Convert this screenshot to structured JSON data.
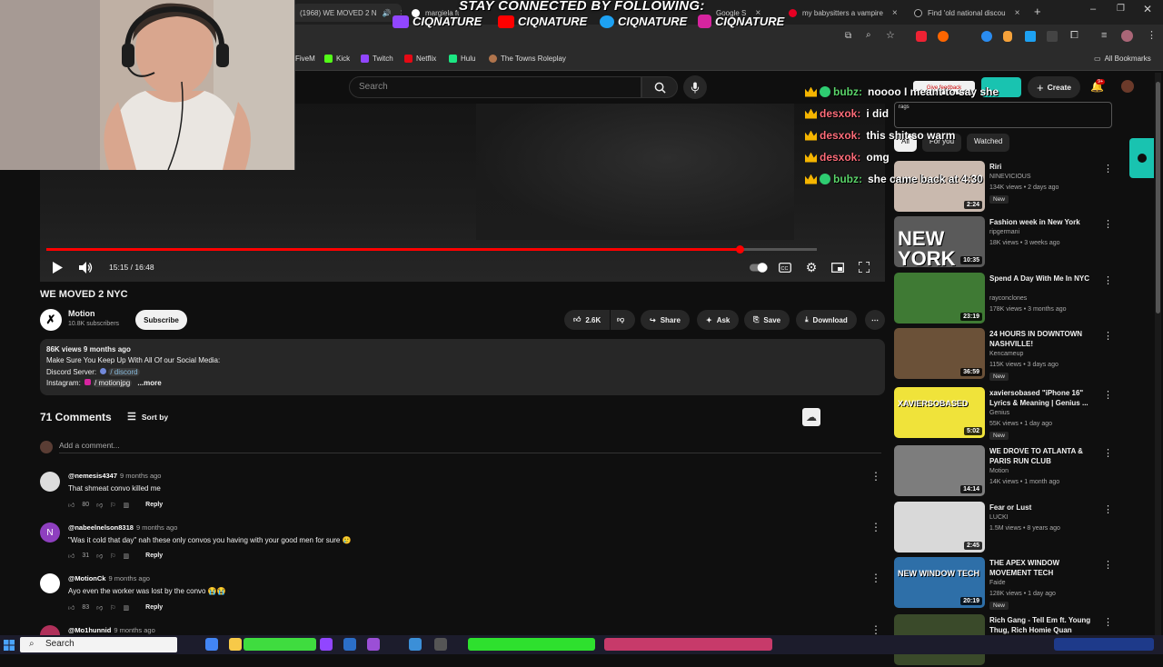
{
  "browser": {
    "tabs": [
      {
        "title": "(1968) WE MOVED 2 N"
      },
      {
        "title": "margiela fu"
      },
      {
        "title": "Google S"
      },
      {
        "title": "my babysitters a vampire"
      },
      {
        "title": "Find 'old national discou"
      }
    ],
    "new_tab": "+",
    "bookmarks": [
      "FiveM",
      "Kick",
      "Twitch",
      "Netflix",
      "Hulu",
      "The Towns Roleplay"
    ],
    "all_bookmarks": "All Bookmarks"
  },
  "overlay": {
    "banner": "STAY CONNECTED BY FOLLOWING:",
    "handles": [
      "CIQNATURE",
      "CIQNATURE",
      "CIQNATURE",
      "CIQNATURE"
    ],
    "chat": [
      {
        "user": "bubz:",
        "message": "noooo I meant to say she",
        "color": "#5bd46a"
      },
      {
        "user": "desxok:",
        "message": "i did",
        "color": "#ff6d7a"
      },
      {
        "user": "desxok:",
        "message": "this shit so warm",
        "color": "#ff6d7a"
      },
      {
        "user": "desxok:",
        "message": "omg",
        "color": "#ff6d7a"
      },
      {
        "user": "bubz:",
        "message": "she came back at 4:30",
        "color": "#5bd46a"
      }
    ]
  },
  "youtube": {
    "search_placeholder": "Search",
    "give_feedback": "Give feedback",
    "create": "Create",
    "notif_badge": "9+",
    "tags_label": "rags",
    "player": {
      "time": "15:15 / 16:48",
      "progress": 0.9
    },
    "video": {
      "title": "WE MOVED 2 NYC",
      "channel": "Motion",
      "subscribers": "10.8K subscribers",
      "subscribe": "Subscribe",
      "likes": "2.6K",
      "share": "Share",
      "ask": "Ask",
      "save": "Save",
      "download": "Download"
    },
    "description": {
      "stats": "86K views  9 months ago",
      "line1": "Make Sure You Keep Up With All Of our Social Media:",
      "discord_label": "Discord Server:",
      "discord_link": "/ discord",
      "instagram_label": "Instagram:",
      "instagram_link": "/ motionjpg",
      "more": "...more"
    },
    "comments": {
      "count": "71 Comments",
      "sort": "Sort by",
      "add_placeholder": "Add a comment...",
      "reply": "Reply",
      "items": [
        {
          "user": "@nemesis4347",
          "time": "9 months ago",
          "text": "That shmeat convo killed me",
          "likes": "80"
        },
        {
          "user": "@nabeelnelson8318",
          "time": "9 months ago",
          "text": "\"Was it cold that day\" nah these only convos you having with your good men for sure 🥲",
          "likes": "31"
        },
        {
          "user": "@MotionCk",
          "time": "9 months ago",
          "text": "Ayo even the worker was lost by the convo 😭😭",
          "likes": "83"
        },
        {
          "user": "@Mo1hunnid",
          "time": "9 months ago",
          "text": "",
          "likes": ""
        }
      ]
    },
    "chips": [
      "All",
      "For you",
      "Watched"
    ],
    "recommendations": [
      {
        "title": "Riri",
        "channel": "NINEVICIOUS",
        "meta": "134K views • 2 days ago",
        "badge": "New",
        "duration": "2:24",
        "color": "#c9b9ae"
      },
      {
        "title": "Fashion week in New York",
        "channel": "ripgermani",
        "meta": "18K views • 3 weeks ago",
        "badge": "",
        "duration": "10:35",
        "color": "#5a5a5a",
        "thumb_text": "NEW YORK"
      },
      {
        "title": "Spend A Day With Me In NYC",
        "channel": "rayconclones",
        "meta": "178K views • 3 months ago",
        "badge": "",
        "duration": "23:19",
        "color": "#3f7a34"
      },
      {
        "title": "24 HOURS IN DOWNTOWN NASHVILLE!",
        "channel": "Kencameup",
        "meta": "115K views • 3 days ago",
        "badge": "New",
        "duration": "36:59",
        "color": "#6b5138"
      },
      {
        "title": "xaviersobased \"iPhone 16\" Lyrics & Meaning | Genius ...",
        "channel": "Genius",
        "meta": "55K views • 1 day ago",
        "badge": "New",
        "duration": "5:02",
        "color": "#f0e33a",
        "thumb_text": "XAVIERSOBASED"
      },
      {
        "title": "WE DROVE TO ATLANTA & PARIS RUN CLUB",
        "channel": "Motion",
        "meta": "14K views • 1 month ago",
        "badge": "",
        "duration": "14:14",
        "color": "#7d7d7d"
      },
      {
        "title": "Fear or Lust",
        "channel": "LUCKI",
        "meta": "1.5M views • 8 years ago",
        "badge": "",
        "duration": "2:45",
        "color": "#d9d9d9"
      },
      {
        "title": "THE APEX WINDOW MOVEMENT TECH",
        "channel": "Faide",
        "meta": "128K views • 1 day ago",
        "badge": "New",
        "duration": "20:19",
        "color": "#2e6fa8",
        "thumb_text": "NEW WINDOW TECH"
      },
      {
        "title": "Rich Gang - Tell Em ft. Young Thug, Rich Homie Quan",
        "channel": "",
        "meta": "",
        "badge": "",
        "duration": "",
        "color": "#3a4a2a"
      }
    ]
  },
  "taskbar": {
    "search": "Search"
  }
}
